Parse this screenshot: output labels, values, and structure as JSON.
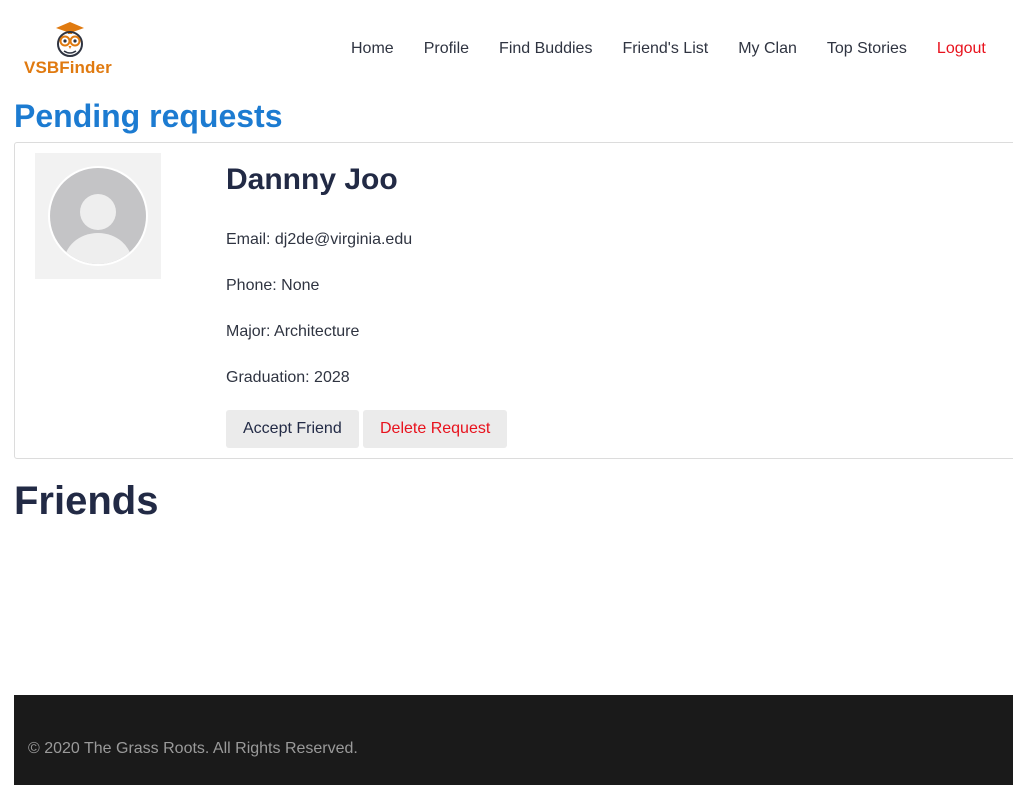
{
  "brand": {
    "name": "VSBFinder",
    "logo_icon": "owl-graduate-icon",
    "color": "#e07a10"
  },
  "nav": {
    "items": [
      {
        "label": "Home"
      },
      {
        "label": "Profile"
      },
      {
        "label": "Find Buddies"
      },
      {
        "label": "Friend's List"
      },
      {
        "label": "My Clan"
      },
      {
        "label": "Top Stories"
      },
      {
        "label": "Logout"
      }
    ]
  },
  "pending": {
    "title": "Pending requests",
    "request": {
      "avatar_icon": "default-user-avatar-icon",
      "name": "Dannny Joo",
      "email": "Email: dj2de@virginia.edu",
      "phone": "Phone: None",
      "major": "Major: Architecture",
      "graduation": "Graduation: 2028",
      "accept_label": "Accept Friend",
      "delete_label": "Delete Request"
    }
  },
  "friends": {
    "title": "Friends"
  },
  "footer": {
    "text": "© 2020 The Grass Roots. All Rights Reserved."
  },
  "colors": {
    "accent": "#1c7bd1",
    "danger": "#e8121d",
    "footer_bg": "#1a1a1a"
  }
}
